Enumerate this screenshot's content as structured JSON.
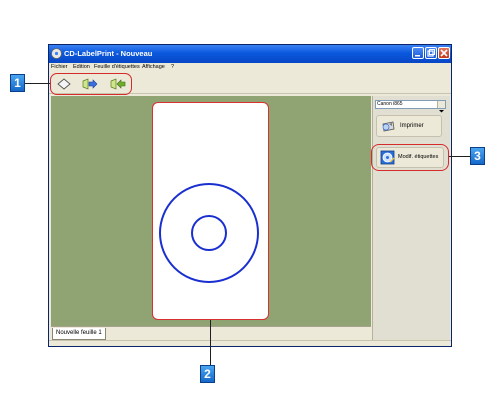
{
  "window": {
    "title": "CD-LabelPrint - Nouveau"
  },
  "menu": {
    "items": [
      "Fichier",
      "Edition",
      "Feuille d'étiquettes",
      "Affichage",
      "?"
    ]
  },
  "toolbar": {
    "icons": [
      "label-shape-icon",
      "forward-arrow-icon",
      "backward-arrow-icon"
    ]
  },
  "sheet": {
    "tab_label": "Nouvelle feuille 1"
  },
  "side_panel": {
    "printer_selected": "Canon i865",
    "print_label": "Imprimer",
    "modify_label": "Modif. étiquettes"
  },
  "callouts": {
    "badge_1": "1",
    "badge_2": "2",
    "badge_3": "3"
  },
  "colors": {
    "title_bar": "#0a58dd",
    "canvas_bg": "#8fa373",
    "disc_stroke": "#1a2fd0",
    "highlight": "#d62b2b",
    "badge": "#1f7fe0"
  }
}
